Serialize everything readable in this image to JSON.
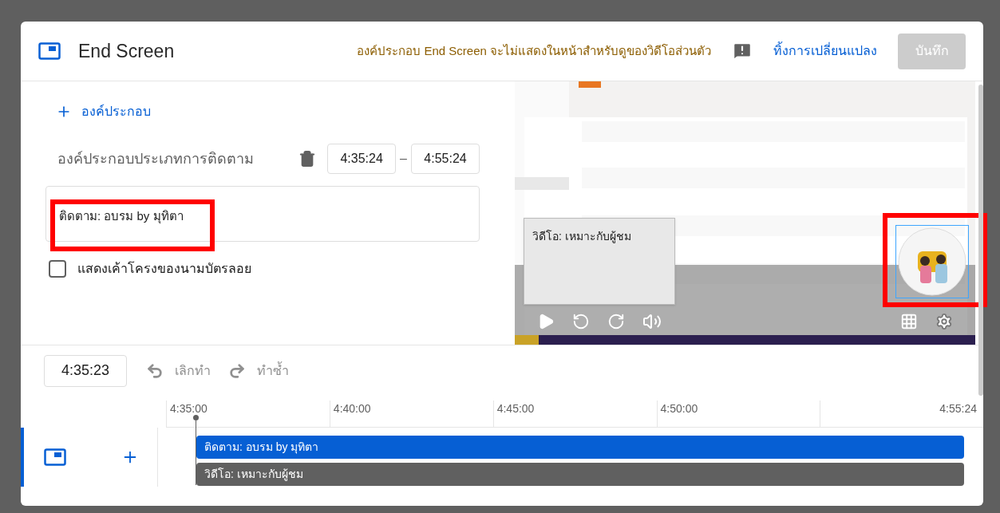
{
  "header": {
    "title": "End Screen",
    "notice": "องค์ประกอบ End Screen จะไม่แสดงในหน้าสำหรับดูของวิดีโอส่วนตัว",
    "discard_link": "ทิ้งการเปลี่ยนแปลง",
    "save_button": {
      "label": "บันทึก",
      "disabled": true
    }
  },
  "editor": {
    "add_button": "องค์ประกอบ",
    "element": {
      "type_label": "องค์ประกอบประเภทการติดตาม",
      "start": "4:35:24",
      "end": "4:55:24",
      "separator": "–",
      "title": "ติดตาม: อบรม by มุทิตา"
    },
    "checkbox": {
      "label": "แสดงเค้าโครงของนามบัตรลอย",
      "checked": false
    }
  },
  "preview": {
    "video_card": "วิดีโอ: เหมาะกับผู้ชม"
  },
  "toolbar": {
    "time": "4:35:23",
    "undo": {
      "label": "เลิกทำ",
      "disabled": true
    },
    "redo": {
      "label": "ทำซ้ำ",
      "disabled": true
    }
  },
  "timeline": {
    "ticks": [
      "4:35:00",
      "4:40:00",
      "4:45:00",
      "4:50:00",
      "4:55:24"
    ],
    "bars": [
      {
        "kind": "subscribe",
        "label": "ติดตาม: อบรม by มุทิตา"
      },
      {
        "kind": "video",
        "label": "วิดีโอ: เหมาะกับผู้ชม"
      }
    ]
  }
}
